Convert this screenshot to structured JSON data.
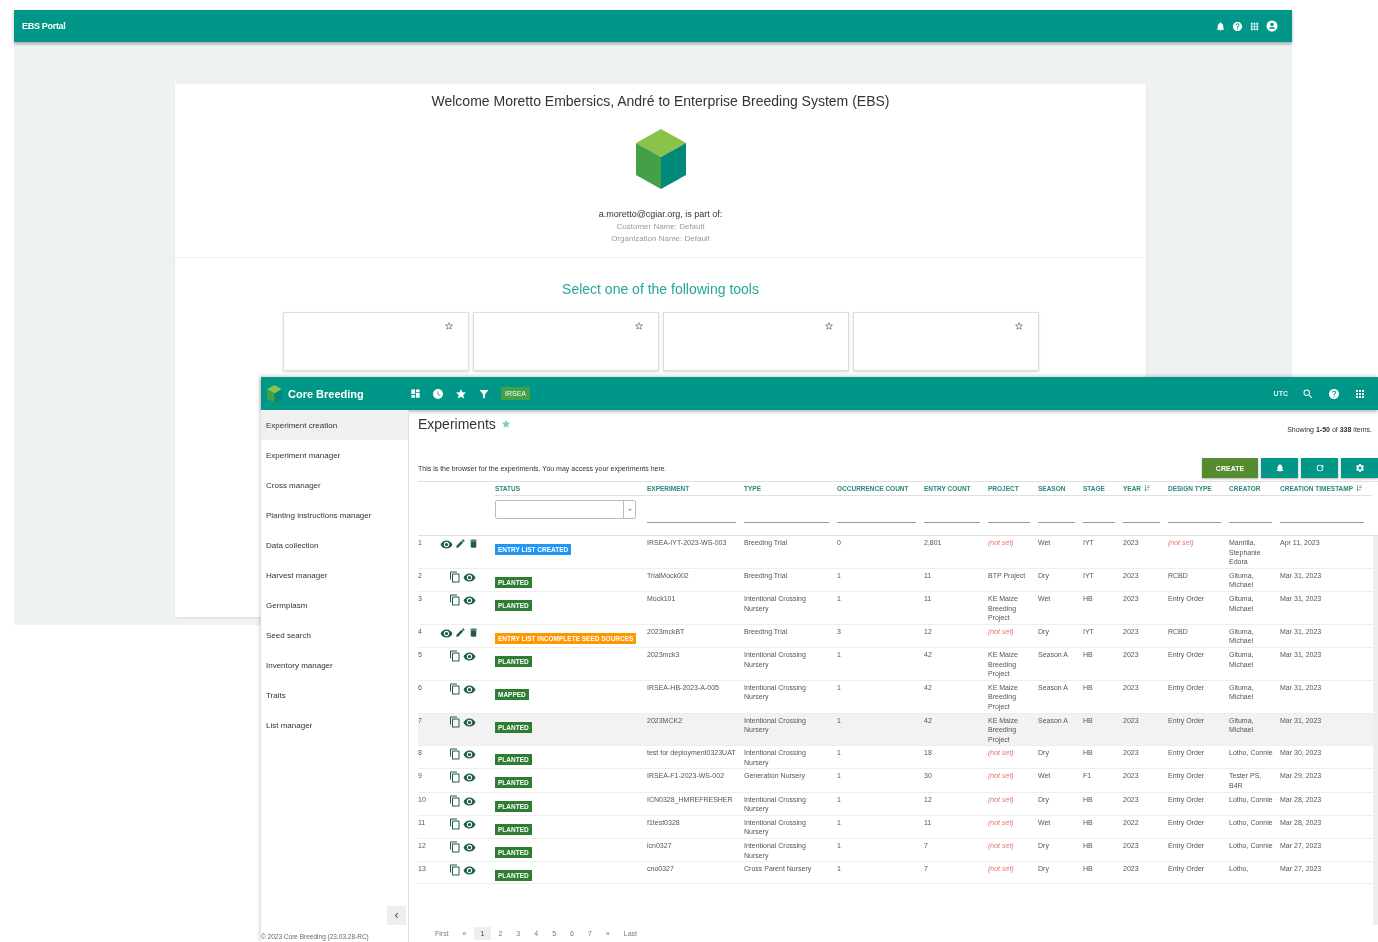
{
  "portal": {
    "title": "EBS Portal",
    "welcome": "Welcome Moretto Embersics, André to Enterprise Breeding System (EBS)",
    "email_line": "a.moretto@cgiar.org, is part of:",
    "customer": "Customer Name: Default",
    "organization": "Organization Name: Default",
    "tools_heading": "Select one of the following tools",
    "tool_cards": [
      {
        "starred": false
      },
      {
        "starred": false
      },
      {
        "starred": false
      },
      {
        "starred": false
      }
    ]
  },
  "app": {
    "title": "Core Breeding",
    "program": "IRSEA",
    "timezone": "UTC",
    "sidebar": {
      "items": [
        {
          "label": "Experiment creation",
          "selected": true
        },
        {
          "label": "Experiment manager",
          "selected": false
        },
        {
          "label": "Cross manager",
          "selected": false
        },
        {
          "label": "Planting instructions manager",
          "selected": false
        },
        {
          "label": "Data collection",
          "selected": false
        },
        {
          "label": "Harvest manager",
          "selected": false
        },
        {
          "label": "Germplasm",
          "selected": false
        },
        {
          "label": "Seed search",
          "selected": false
        },
        {
          "label": "Inventory manager",
          "selected": false
        },
        {
          "label": "Traits",
          "selected": false
        },
        {
          "label": "List manager",
          "selected": false
        }
      ],
      "footer": "© 2023 Core Breeding (23.03.28-RC)"
    },
    "page": {
      "title": "Experiments",
      "description": "This is the browser for the experiments. You may access your experiments here.",
      "summary": "Showing **1-50** of **338** items.",
      "create_label": "CREATE"
    },
    "table": {
      "columns": [
        {
          "label": "STATUS",
          "sortable": false
        },
        {
          "label": "EXPERIMENT",
          "sortable": false
        },
        {
          "label": "TYPE",
          "sortable": false
        },
        {
          "label": "OCCURRENCE COUNT",
          "sortable": false
        },
        {
          "label": "ENTRY COUNT",
          "sortable": false
        },
        {
          "label": "PROJECT",
          "sortable": false
        },
        {
          "label": "SEASON",
          "sortable": false
        },
        {
          "label": "STAGE",
          "sortable": false
        },
        {
          "label": "YEAR",
          "sortable": true
        },
        {
          "label": "DESIGN TYPE",
          "sortable": false
        },
        {
          "label": "CREATOR",
          "sortable": false
        },
        {
          "label": "CREATION TIMESTAMP",
          "sortable": true
        }
      ],
      "rows": [
        {
          "number": "1",
          "kind": "editable",
          "highlighted": false,
          "status": "ENTRY LIST CREATED",
          "color": "#2196f3",
          "experiment": "IRSEA-IYT-2023-WS-003",
          "type": "Breeding Trial",
          "occurrence_count": "0",
          "entry_count": "2,801",
          "project": "(not set)",
          "project_missing": true,
          "season": "Wet",
          "stage": "IYT",
          "year": "2023",
          "design_type": "(not set)",
          "design_missing": true,
          "creator": "Manrilla, Stephanie Edora",
          "creation_timestamp": "Apr 11, 2023"
        },
        {
          "number": "2",
          "kind": "copyable",
          "highlighted": false,
          "status": "PLANTED",
          "color": "#2e7d32",
          "experiment": "TrialMock002",
          "type": "Breeding Trial",
          "occurrence_count": "1",
          "entry_count": "11",
          "project": "BTP Project",
          "project_missing": false,
          "season": "Dry",
          "stage": "IYT",
          "year": "2023",
          "design_type": "RCBD",
          "design_missing": false,
          "creator": "Gituma, Michael",
          "creation_timestamp": "Mar 31, 2023"
        },
        {
          "number": "3",
          "kind": "copyable",
          "highlighted": false,
          "status": "PLANTED",
          "color": "#2e7d32",
          "experiment": "Mock101",
          "type": "Intentional Crossing Nursery",
          "occurrence_count": "1",
          "entry_count": "11",
          "project": "KE Maize Breeding Project",
          "project_missing": false,
          "season": "Wet",
          "stage": "HB",
          "year": "2023",
          "design_type": "Entry Order",
          "design_missing": false,
          "creator": "Gituma, Michael",
          "creation_timestamp": "Mar 31, 2023"
        },
        {
          "number": "4",
          "kind": "editable",
          "highlighted": false,
          "status": "ENTRY LIST INCOMPLETE SEED SOURCES",
          "color": "#ff9800",
          "experiment": "2023mckBT",
          "type": "Breeding Trial",
          "occurrence_count": "3",
          "entry_count": "12",
          "project": "(not set)",
          "project_missing": true,
          "season": "Dry",
          "stage": "IYT",
          "year": "2023",
          "design_type": "RCBD",
          "design_missing": false,
          "creator": "Gituma, Michael",
          "creation_timestamp": "Mar 31, 2023"
        },
        {
          "number": "5",
          "kind": "copyable",
          "highlighted": false,
          "status": "PLANTED",
          "color": "#2e7d32",
          "experiment": "2023mck3",
          "type": "Intentional Crossing Nursery",
          "occurrence_count": "1",
          "entry_count": "42",
          "project": "KE Maize Breeding Project",
          "project_missing": false,
          "season": "Season A",
          "stage": "HB",
          "year": "2023",
          "design_type": "Entry Order",
          "design_missing": false,
          "creator": "Gituma, Michael",
          "creation_timestamp": "Mar 31, 2023"
        },
        {
          "number": "6",
          "kind": "copyable",
          "highlighted": false,
          "status": "MAPPED",
          "color": "#2e7d32",
          "experiment": "IRSEA-HB-2023-A-005",
          "type": "Intentional Crossing Nursery",
          "occurrence_count": "1",
          "entry_count": "42",
          "project": "KE Maize Breeding Project",
          "project_missing": false,
          "season": "Season A",
          "stage": "HB",
          "year": "2023",
          "design_type": "Entry Order",
          "design_missing": false,
          "creator": "Gituma, Michael",
          "creation_timestamp": "Mar 31, 2023"
        },
        {
          "number": "7",
          "kind": "copyable",
          "highlighted": true,
          "status": "PLANTED",
          "color": "#2e7d32",
          "experiment": "2023MCK2",
          "type": "Intentional Crossing Nursery",
          "occurrence_count": "1",
          "entry_count": "42",
          "project": "KE Maize Breeding Project",
          "project_missing": false,
          "season": "Season A",
          "stage": "HB",
          "year": "2023",
          "design_type": "Entry Order",
          "design_missing": false,
          "creator": "Gituma, Michael",
          "creation_timestamp": "Mar 31, 2023"
        },
        {
          "number": "8",
          "kind": "copyable",
          "highlighted": false,
          "status": "PLANTED",
          "color": "#2e7d32",
          "experiment": "test for deployment0323UAT",
          "type": "Intentional Crossing Nursery",
          "occurrence_count": "1",
          "entry_count": "18",
          "project": "(not set)",
          "project_missing": true,
          "season": "Dry",
          "stage": "HB",
          "year": "2023",
          "design_type": "Entry Order",
          "design_missing": false,
          "creator": "Lotho, Connie",
          "creation_timestamp": "Mar 30, 2023"
        },
        {
          "number": "9",
          "kind": "copyable",
          "highlighted": false,
          "status": "PLANTED",
          "color": "#2e7d32",
          "experiment": "IRSEA-F1-2023-WS-002",
          "type": "Generation Nursery",
          "occurrence_count": "1",
          "entry_count": "30",
          "project": "(not set)",
          "project_missing": true,
          "season": "Wet",
          "stage": "F1",
          "year": "2023",
          "design_type": "Entry Order",
          "design_missing": false,
          "creator": "Tester PS, B4R",
          "creation_timestamp": "Mar 29, 2023"
        },
        {
          "number": "10",
          "kind": "copyable",
          "highlighted": false,
          "status": "PLANTED",
          "color": "#2e7d32",
          "experiment": "ICN0328_HMREFRESHER",
          "type": "Intentional Crossing Nursery",
          "occurrence_count": "1",
          "entry_count": "12",
          "project": "(not set)",
          "project_missing": true,
          "season": "Dry",
          "stage": "HB",
          "year": "2023",
          "design_type": "Entry Order",
          "design_missing": false,
          "creator": "Lotho, Connie",
          "creation_timestamp": "Mar 28, 2023"
        },
        {
          "number": "11",
          "kind": "copyable",
          "highlighted": false,
          "status": "PLANTED",
          "color": "#2e7d32",
          "experiment": "f1test0328",
          "type": "Intentional Crossing Nursery",
          "occurrence_count": "1",
          "entry_count": "11",
          "project": "(not set)",
          "project_missing": true,
          "season": "Wet",
          "stage": "HB",
          "year": "2022",
          "design_type": "Entry Order",
          "design_missing": false,
          "creator": "Lotho, Connie",
          "creation_timestamp": "Mar 28, 2023"
        },
        {
          "number": "12",
          "kind": "copyable",
          "highlighted": false,
          "status": "PLANTED",
          "color": "#2e7d32",
          "experiment": "icn0327",
          "type": "Intentional Crossing Nursery",
          "occurrence_count": "1",
          "entry_count": "7",
          "project": "(not set)",
          "project_missing": true,
          "season": "Dry",
          "stage": "HB",
          "year": "2023",
          "design_type": "Entry Order",
          "design_missing": false,
          "creator": "Lotho, Connie",
          "creation_timestamp": "Mar 27, 2023"
        },
        {
          "number": "13",
          "kind": "copyable",
          "highlighted": false,
          "status": "PLANTED",
          "color": "#2e7d32",
          "experiment": "cno0327",
          "type": "Cross Parent Nursery",
          "occurrence_count": "1",
          "entry_count": "7",
          "project": "(not set)",
          "project_missing": true,
          "season": "Dry",
          "stage": "HB",
          "year": "2023",
          "design_type": "Entry Order",
          "design_missing": false,
          "creator": "Lotho,",
          "creation_timestamp": "Mar 27, 2023"
        }
      ]
    },
    "pagination": {
      "first": "First",
      "previous": "«",
      "next": "»",
      "last": "Last",
      "pages": [
        {
          "label": "1",
          "selected": true
        },
        {
          "label": "2",
          "selected": false
        },
        {
          "label": "3",
          "selected": false
        },
        {
          "label": "4",
          "selected": false
        },
        {
          "label": "5",
          "selected": false
        },
        {
          "label": "6",
          "selected": false
        },
        {
          "label": "7",
          "selected": false
        }
      ]
    }
  }
}
